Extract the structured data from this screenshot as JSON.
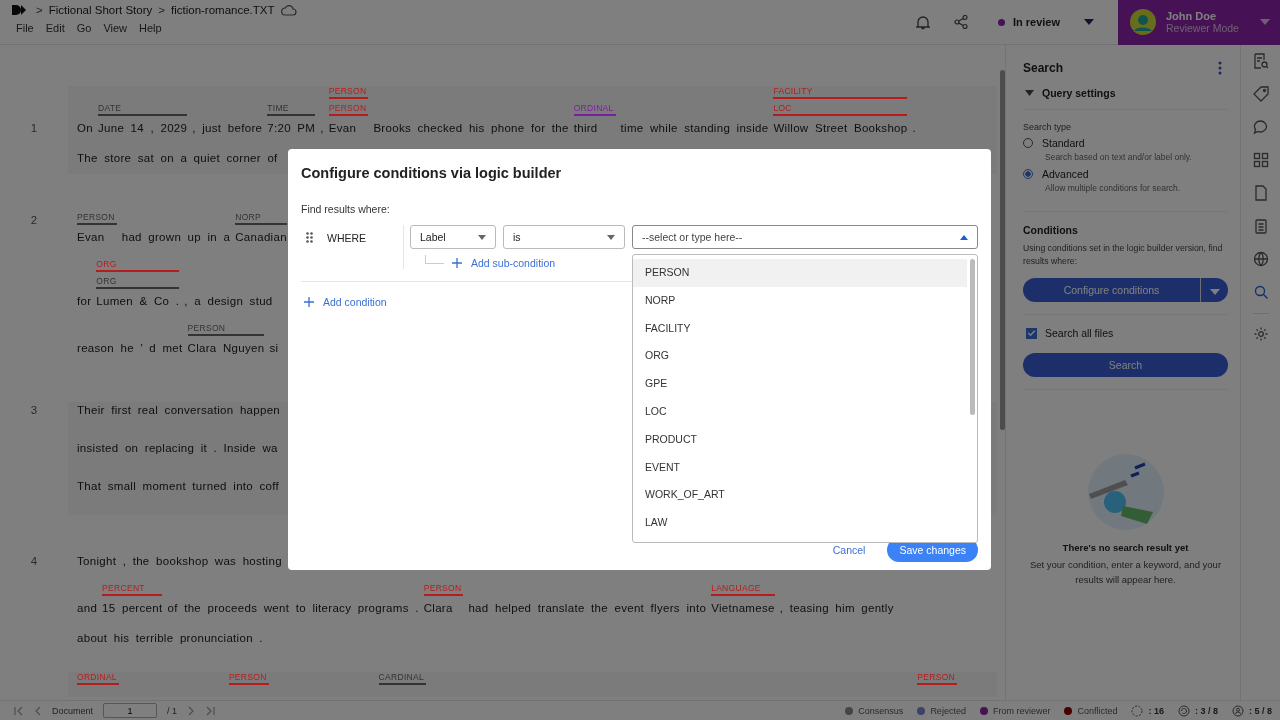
{
  "topbar": {
    "breadcrumb": [
      {
        "kind": "separator",
        "text": ">"
      },
      {
        "kind": "link",
        "text": "Fictional Short Story"
      },
      {
        "kind": "separator",
        "text": ">"
      },
      {
        "kind": "current",
        "text": "fiction-romance.TXT"
      }
    ],
    "menus": [
      "File",
      "Edit",
      "Go",
      "View",
      "Help"
    ],
    "status": {
      "label": "In review",
      "color": "#471255"
    },
    "user": {
      "name": "John Doe",
      "role": "Reviewer Mode"
    }
  },
  "document": {
    "paragraphs": [
      {
        "number": "1",
        "lines": [
          [
            {
              "text": "On"
            },
            {
              "text": "June 14 , 2029",
              "labels": [
                {
                  "name": "DATE",
                  "color": "#333333"
                }
              ]
            },
            {
              "text": ", just before"
            },
            {
              "text": "7:20 PM",
              "labels": [
                {
                  "name": "TIME",
                  "color": "#333333"
                }
              ]
            },
            {
              "text": ","
            },
            {
              "text": "Evan",
              "labels": [
                {
                  "name": "PERSON",
                  "color": "#b71c1c"
                },
                {
                  "name": "PERSON",
                  "color": "#b71c1c"
                }
              ]
            },
            {
              "text": "Brooks checked his phone for the"
            },
            {
              "text": "third",
              "labels": [
                {
                  "name": "ORDINAL",
                  "color": "#7b1fa2"
                }
              ]
            },
            {
              "text": "time while standing inside"
            },
            {
              "text": "Willow Street Bookshop",
              "labels": [
                {
                  "name": "FACILITY",
                  "color": "#b71c1c"
                },
                {
                  "name": "LOC",
                  "color": "#b71c1c"
                }
              ]
            },
            {
              "text": "."
            }
          ],
          [
            {
              "text": "The store sat on a quiet corner of"
            }
          ]
        ]
      },
      {
        "number": "2",
        "lines": [
          [
            {
              "text": "Evan",
              "labels": [
                {
                  "name": "PERSON",
                  "color": "#333333"
                }
              ]
            },
            {
              "text": "had grown up in a"
            },
            {
              "text": "Canadian",
              "labels": [
                {
                  "name": "NORP",
                  "color": "#333333"
                }
              ]
            }
          ],
          [
            {
              "text": "for"
            },
            {
              "text": "Lumen & Co .",
              "labels": [
                {
                  "name": "ORG",
                  "color": "#b71c1c"
                },
                {
                  "name": "ORG",
                  "color": "#333333"
                }
              ]
            },
            {
              "text": ", a design stud"
            }
          ],
          [
            {
              "text": "reason he ’ d met"
            },
            {
              "text": "Clara Nguyen",
              "labels": [
                {
                  "name": "PERSON",
                  "color": "#333333"
                }
              ]
            },
            {
              "text": "si"
            }
          ]
        ]
      },
      {
        "number": "3",
        "lines": [
          [
            {
              "text": "Their first real conversation happen"
            }
          ],
          [
            {
              "text": "insisted on replacing it .  Inside wa"
            }
          ],
          [
            {
              "text": "That small moment turned into coff"
            }
          ]
        ]
      },
      {
        "number": "4",
        "lines": [
          [
            {
              "text": "Tonight , the bookshop was hosting"
            }
          ],
          [
            {
              "text": "and"
            },
            {
              "text": "15 percent",
              "labels": [
                {
                  "name": "PERCENT",
                  "color": "#b71c1c"
                }
              ]
            },
            {
              "text": "of the proceeds went to literacy programs ."
            },
            {
              "text": "Clara",
              "labels": [
                {
                  "name": "PERSON",
                  "color": "#b71c1c"
                }
              ]
            },
            {
              "text": "had helped translate the event flyers into"
            },
            {
              "text": "Vietnamese",
              "labels": [
                {
                  "name": "LANGUAGE",
                  "color": "#b71c1c"
                }
              ]
            },
            {
              "text": ", teasing him gently"
            }
          ],
          [
            {
              "text": "about his terrible pronunciation ."
            }
          ]
        ]
      },
      {
        "lines": [
          [
            {
              "labels": [
                {
                  "name": "ORDINAL",
                  "color": "#b71c1c"
                }
              ]
            },
            {
              "labels": [
                {
                  "name": "PERSON",
                  "color": "#b71c1c"
                }
              ]
            },
            {
              "labels": [
                {
                  "name": "CARDINAL",
                  "color": "#333333"
                }
              ]
            },
            {
              "labels": [
                {
                  "name": "PERSON",
                  "color": "#b71c1c"
                }
              ]
            }
          ]
        ]
      }
    ]
  },
  "search_panel": {
    "title": "Search",
    "query_settings": {
      "label": "Query settings",
      "expanded": true
    },
    "search_type_label": "Search type",
    "search_types": [
      {
        "label": "Standard",
        "description": "Search based on text and/or label only.",
        "selected": false
      },
      {
        "label": "Advanced",
        "description": "Allow multiple conditions for search.",
        "selected": true
      }
    ],
    "conditions": {
      "title": "Conditions",
      "description": "Using conditions set in the logic builder version, find results where:",
      "button": "Configure conditions"
    },
    "search_all_files": {
      "label": "Search all files",
      "checked": true
    },
    "search_button": "Search",
    "empty": {
      "title": "There's no search result yet",
      "description": "Set your condition, enter a keyword, and your results will appear here."
    }
  },
  "rail": [
    {
      "kind": "doc-search",
      "selected": false
    },
    {
      "kind": "tag",
      "selected": false
    },
    {
      "kind": "comment",
      "selected": false
    },
    {
      "kind": "grid",
      "selected": false
    },
    {
      "kind": "file",
      "selected": false
    },
    {
      "kind": "clipboard",
      "selected": false
    },
    {
      "kind": "globe",
      "selected": false
    },
    {
      "kind": "search",
      "selected": true
    },
    {
      "kind": "gear",
      "selected": false
    }
  ],
  "bottom_bar": {
    "pager": {
      "label": "Document",
      "page": "1",
      "total": "/ 1"
    },
    "legend": [
      {
        "label": "Consensus",
        "color": "#454545"
      },
      {
        "label": "Rejected",
        "color": "#3c4366"
      },
      {
        "label": "From reviewer",
        "color": "#471255"
      },
      {
        "label": "Conflicted",
        "color": "#460000"
      }
    ],
    "counters": [
      {
        "kind": "labels",
        "value": ": 16"
      },
      {
        "kind": "reviewed",
        "value": ": 3 / 8"
      },
      {
        "kind": "annotators",
        "value": ": 5 / 8"
      }
    ]
  },
  "dialog": {
    "title": "Configure conditions via logic builder",
    "subtitle": "Find results where:",
    "condition": {
      "operator": "WHERE",
      "field": "Label",
      "comparator": "is",
      "value_placeholder": "--select or type here--",
      "expanded": true
    },
    "add_sub_condition": "Add sub-condition",
    "add_condition": "Add condition",
    "cancel": "Cancel",
    "save": "Save changes",
    "options": [
      {
        "label": "PERSON",
        "highlighted": true
      },
      {
        "label": "NORP",
        "highlighted": false
      },
      {
        "label": "FACILITY",
        "highlighted": false
      },
      {
        "label": "ORG",
        "highlighted": false
      },
      {
        "label": "GPE",
        "highlighted": false
      },
      {
        "label": "LOC",
        "highlighted": false
      },
      {
        "label": "PRODUCT",
        "highlighted": false
      },
      {
        "label": "EVENT",
        "highlighted": false
      },
      {
        "label": "WORK_OF_ART",
        "highlighted": false
      },
      {
        "label": "LAW",
        "highlighted": false
      }
    ]
  }
}
